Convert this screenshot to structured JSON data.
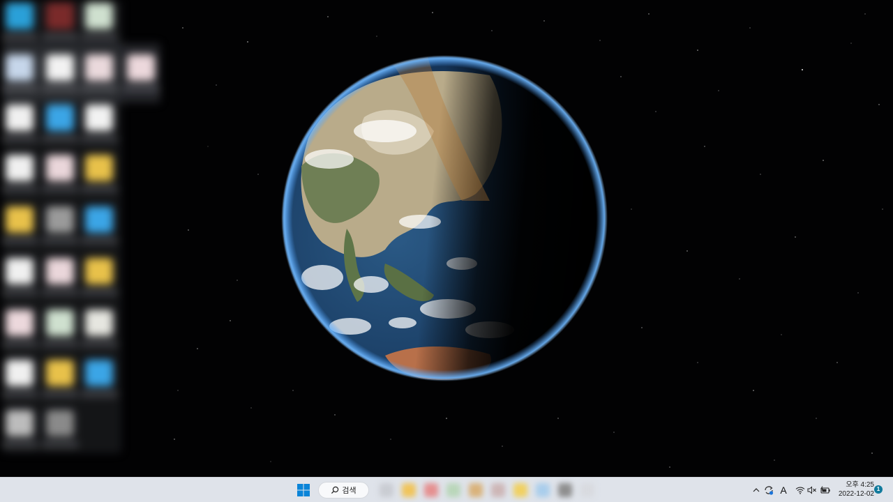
{
  "taskbar": {
    "search_label": "검색",
    "clock": {
      "time": "오후 4:25",
      "date": "2022-12-02"
    },
    "notification_count": "1",
    "tray_icons": [
      "chevron-up-icon",
      "sync-icon",
      "ime-icon",
      "wifi-icon",
      "volume-muted-icon",
      "battery-charging-icon"
    ],
    "ime_label": "A"
  },
  "desktop": {
    "wallpaper": "earth-from-space",
    "icons_blurred": true
  },
  "colors": {
    "taskbar_bg": "#dfe3ea",
    "start_blue": "#0a84d8",
    "notification_badge": "#117a9c",
    "space": "#020203"
  }
}
